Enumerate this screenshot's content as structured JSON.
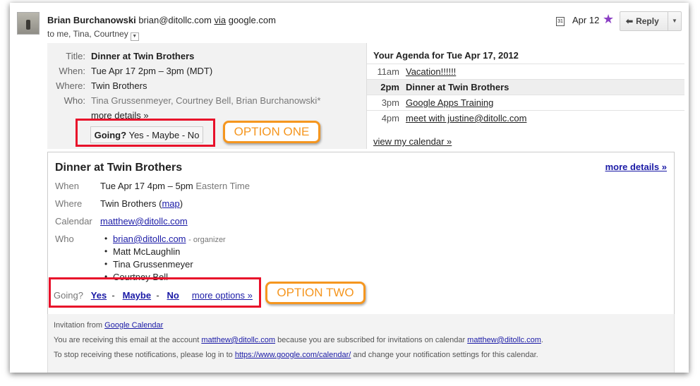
{
  "sender": {
    "name": "Brian Burchanowski",
    "email": "brian@ditollc.com",
    "via_label": "via",
    "via_domain": "google.com"
  },
  "recipients": "to me, Tina, Courtney",
  "date": "Apr 12",
  "reply_label": "Reply",
  "invitation": {
    "labels": {
      "title": "Title:",
      "when": "When:",
      "where": "Where:",
      "who": "Who:"
    },
    "title": "Dinner at Twin Brothers",
    "when": "Tue Apr 17 2pm – 3pm (MDT)",
    "where": "Twin Brothers",
    "who": "Tina Grussenmeyer, Courtney Bell, Brian Burchanowski*",
    "more_details": "more details »",
    "going_label": "Going?",
    "going_options": "Yes - Maybe - No"
  },
  "agenda": {
    "title": "Your Agenda for Tue Apr 17, 2012",
    "rows": [
      {
        "time": "11am",
        "event": "Vacation!!!!!!"
      },
      {
        "time": "2pm",
        "event": "Dinner at Twin Brothers"
      },
      {
        "time": "3pm",
        "event": "Google Apps Training"
      },
      {
        "time": "4pm",
        "event": "meet with justine@ditollc.com"
      }
    ],
    "view_link": "view my calendar »"
  },
  "annotations": {
    "option_one": "OPTION ONE",
    "option_two": "OPTION TWO"
  },
  "card": {
    "title": "Dinner at Twin Brothers",
    "more_details": "more details »",
    "labels": {
      "when": "When",
      "where": "Where",
      "calendar": "Calendar",
      "who": "Who"
    },
    "when": "Tue Apr 17 4pm – 5pm",
    "timezone": "Eastern Time",
    "where": "Twin Brothers",
    "map_link": "map",
    "calendar": "matthew@ditollc.com",
    "guests": {
      "organizer": "brian@ditollc.com",
      "organizer_note": "- organizer",
      "others": [
        "Matt McLaughlin",
        "Tina Grussenmeyer",
        "Courtney Bell"
      ]
    },
    "going_label": "Going?",
    "yes": "Yes",
    "maybe": "Maybe",
    "no": "No",
    "separator": "-",
    "more_options": "more options »"
  },
  "footer": {
    "line1_prefix": "Invitation from",
    "line1_link": "Google Calendar",
    "line2_a": "You are receiving this email at the account",
    "line2_email1": "matthew@ditollc.com",
    "line2_b": "because you are subscribed for invitations on calendar",
    "line2_email2": "matthew@ditollc.com",
    "line2_end": ".",
    "line3_a": "To stop receiving these notifications, please log in to",
    "line3_link": "https://www.google.com/calendar/",
    "line3_b": "and change your notification settings for this calendar."
  }
}
